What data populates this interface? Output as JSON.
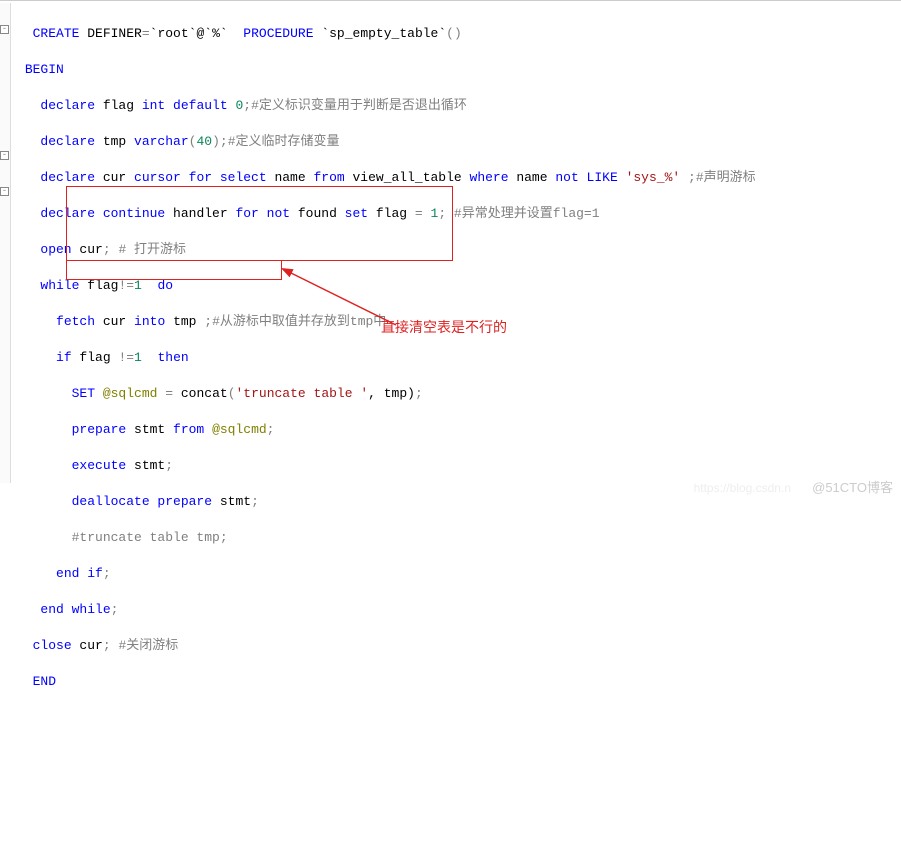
{
  "fold_glyph": "-",
  "annotation": "直接清空表是不行的",
  "watermark_main": "@51CTO博客",
  "watermark_faint": "https://blog.csdn.n",
  "code": {
    "l1_kw1": "CREATE",
    "l1_def": " DEFINER",
    "l1_eq": "=",
    "l1_q1": "`root`",
    "l1_at": "@",
    "l1_q2": "`%`",
    "l1_sp": "  ",
    "l1_kw2": "PROCEDURE",
    "l1_sp2": " ",
    "l1_q3": "`sp_empty_table`",
    "l1_par": "()",
    "l2_kw": "BEGIN",
    "l3_kw": "declare",
    "l3_id": " flag ",
    "l3_ty": "int",
    "l3_sp": " ",
    "l3_kw2": "default",
    "l3_sp2": " ",
    "l3_num": "0",
    "l3_semi": ";",
    "l3_cmt": "#定义标识变量用于判断是否退出循环",
    "l4_kw": "declare",
    "l4_id": " tmp ",
    "l4_ty": "varchar",
    "l4_par": "(",
    "l4_num": "40",
    "l4_par2": ")",
    "l4_semi": ";",
    "l4_cmt": "#定义临时存储变量",
    "l5_kw": "declare",
    "l5_id": " cur ",
    "l5_kw2": "cursor for select",
    "l5_id2": " name ",
    "l5_kw3": "from",
    "l5_id3": " view_all_table ",
    "l5_kw4": "where",
    "l5_id4": " name ",
    "l5_kw5": "not LIKE",
    "l5_sp": " ",
    "l5_str": "'sys_%'",
    "l5_sp2": " ",
    "l5_semi": ";",
    "l5_cmt": "#声明游标",
    "l6_kw": "declare continue",
    "l6_id": " handler ",
    "l6_kw2": "for not",
    "l6_id2": " found ",
    "l6_kw3": "set",
    "l6_id3": " flag ",
    "l6_eq": "= ",
    "l6_num": "1",
    "l6_semi": "; ",
    "l6_cmt": "#异常处理并设置flag=1",
    "l7_kw": "open",
    "l7_id": " cur",
    "l7_semi": "; ",
    "l7_cmt": "# 打开游标",
    "l8_kw": "while",
    "l8_id": " flag",
    "l8_ne": "!=",
    "l8_num": "1",
    "l8_sp": "  ",
    "l8_kw2": "do",
    "l9_kw": "fetch",
    "l9_id": " cur ",
    "l9_kw2": "into",
    "l9_id2": " tmp ",
    "l9_semi": ";",
    "l9_cmt": "#从游标中取值并存放到tmp中",
    "l10_kw": "if",
    "l10_id": " flag ",
    "l10_ne": "!=",
    "l10_num": "1",
    "l10_sp": "  ",
    "l10_kw2": "then",
    "l11_kw": "SET",
    "l11_sp": " ",
    "l11_sys": "@sqlcmd",
    "l11_sp2": " ",
    "l11_eq": "=",
    "l11_sp3": " ",
    "l11_fn": "concat",
    "l11_par": "(",
    "l11_str": "'truncate table '",
    "l11_comma": ", tmp)",
    "l11_semi": ";",
    "l12_kw": "prepare",
    "l12_id": " stmt ",
    "l12_kw2": "from",
    "l12_sp": " ",
    "l12_sys": "@sqlcmd",
    "l12_semi": ";",
    "l13_kw": "execute",
    "l13_id": " stmt",
    "l13_semi": ";",
    "l14_kw": "deallocate prepare",
    "l14_id": " stmt",
    "l14_semi": ";",
    "l15_cmt": "#truncate table tmp;",
    "l16_kw": "end if",
    "l16_semi": ";",
    "l17_kw": "end while",
    "l17_semi": ";",
    "l18_kw": "close",
    "l18_id": " cur",
    "l18_semi": "; ",
    "l18_cmt": "#关闭游标",
    "l19_kw": "END"
  }
}
